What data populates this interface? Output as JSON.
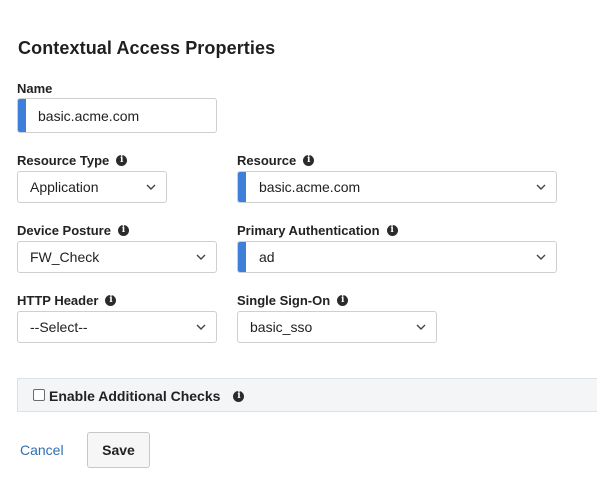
{
  "page": {
    "title": "Contextual Access Properties"
  },
  "name_field": {
    "label": "Name",
    "value": "basic.acme.com"
  },
  "resource_type": {
    "label": "Resource Type",
    "value": "Application"
  },
  "resource": {
    "label": "Resource",
    "value": "basic.acme.com"
  },
  "device_posture": {
    "label": "Device Posture",
    "value": "FW_Check"
  },
  "primary_authentication": {
    "label": "Primary Authentication",
    "value": "ad"
  },
  "http_header": {
    "label": "HTTP Header",
    "value": "--Select--"
  },
  "single_sign_on": {
    "label": "Single Sign-On",
    "value": "basic_sso"
  },
  "additional_checks": {
    "label": "Enable Additional Checks",
    "checked": false
  },
  "actions": {
    "cancel_label": "Cancel",
    "save_label": "Save"
  },
  "icons": {
    "info": "info-icon",
    "dropdown": "chevron-down-icon"
  },
  "colors": {
    "required_indicator": "#3e7fd9",
    "link": "#2f6fb3"
  }
}
